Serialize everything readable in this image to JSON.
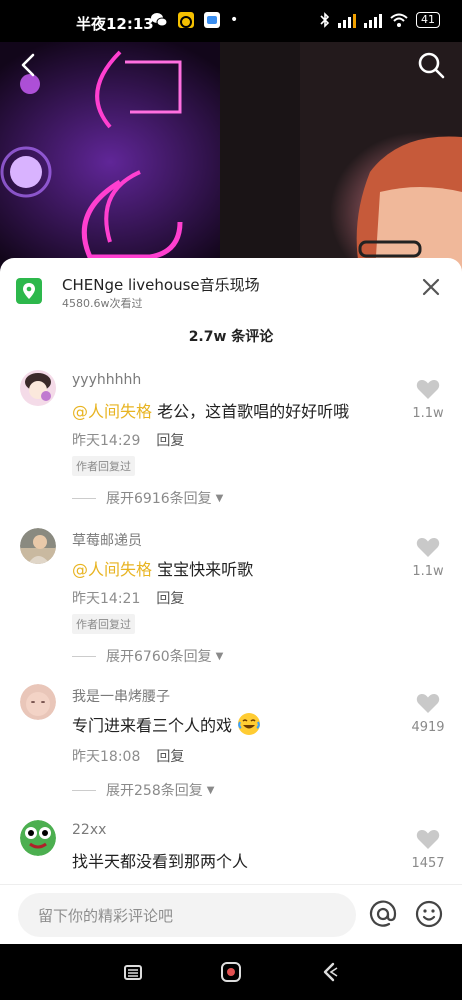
{
  "status_bar": {
    "time": "半夜12:13",
    "battery": "41"
  },
  "location": {
    "title": "CHENge livehouse音乐现场",
    "views": "4580.6w次看过"
  },
  "comments_header": {
    "count": "2.7w 条评论"
  },
  "comments": [
    {
      "username": "yyyhhhhh",
      "mention": "@人间失格",
      "text": " 老公，这首歌唱的好好听哦",
      "time": "昨天14:29",
      "reply": "回复",
      "tag": "作者回复过",
      "expand": "展开6916条回复",
      "likes": "1.1w"
    },
    {
      "username": "草莓邮递员",
      "mention": "@人间失格",
      "text": " 宝宝快来听歌",
      "time": "昨天14:21",
      "reply": "回复",
      "tag": "作者回复过",
      "expand": "展开6760条回复",
      "likes": "1.1w"
    },
    {
      "username": "我是一串烤腰子",
      "text": "专门进来看三个人的戏",
      "time": "昨天18:08",
      "reply": "回复",
      "expand": "展开258条回复",
      "likes": "4919"
    },
    {
      "username": "22xx",
      "text": "找半天都没看到那两个人",
      "likes": "1457"
    }
  ],
  "input": {
    "placeholder": "留下你的精彩评论吧"
  },
  "colors": {
    "mention": "#e8b422",
    "location_icon": "#2db84c",
    "neon": "#ff3fd0"
  }
}
